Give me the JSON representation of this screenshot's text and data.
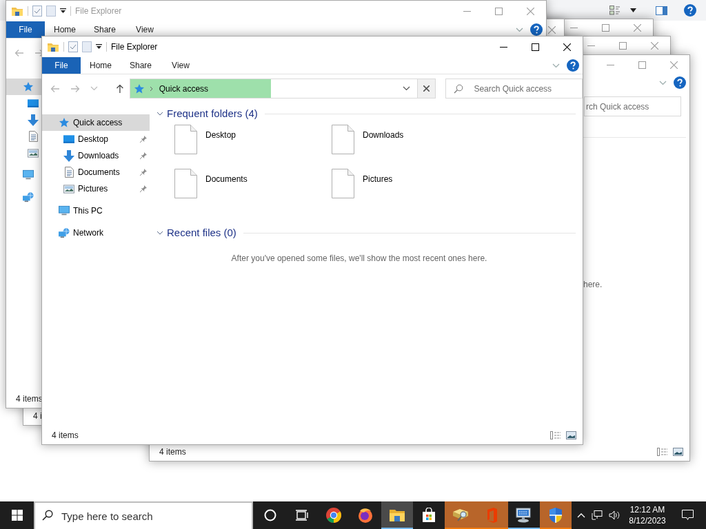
{
  "window_back_right": {
    "search_placeholder": "rch Quick access",
    "message": "here.",
    "status": "4 items"
  },
  "window_back_lower": {
    "status": "4 i"
  },
  "window_back_left": {
    "title": "File Explorer",
    "ribbon_tabs": [
      {
        "label": "File",
        "selected": true
      },
      {
        "label": "Home",
        "selected": false
      },
      {
        "label": "Share",
        "selected": false
      },
      {
        "label": "View",
        "selected": false
      }
    ],
    "nav": [
      {
        "kind": "quick_access",
        "selected": true,
        "children": [
          {
            "kind": "desktop",
            "selected": false
          },
          {
            "kind": "downloads",
            "selected": false
          },
          {
            "kind": "documents",
            "selected": false
          },
          {
            "kind": "pictures",
            "selected": false
          }
        ]
      },
      {
        "kind": "pc",
        "selected": false
      },
      {
        "kind": "network",
        "selected": false
      }
    ],
    "status": "4 items"
  },
  "main_window": {
    "title": "File Explorer",
    "ribbon_tabs": [
      {
        "label": "File",
        "selected": true
      },
      {
        "label": "Home",
        "selected": false
      },
      {
        "label": "Share",
        "selected": false
      },
      {
        "label": "View",
        "selected": false
      }
    ],
    "address": {
      "location": "Quick access",
      "level": 0.53
    },
    "search_placeholder": "Search Quick access",
    "nav": [
      {
        "label": "Quick access",
        "kind": "quick_access",
        "selected": true,
        "children": [
          {
            "label": "Desktop",
            "kind": "desktop",
            "selected": false,
            "pinned": true
          },
          {
            "label": "Downloads",
            "kind": "downloads",
            "selected": false,
            "pinned": true
          },
          {
            "label": "Documents",
            "kind": "documents",
            "selected": false,
            "pinned": true
          },
          {
            "label": "Pictures",
            "kind": "pictures",
            "selected": false,
            "pinned": true
          }
        ]
      },
      {
        "label": "This PC",
        "kind": "pc",
        "selected": false
      },
      {
        "label": "Network",
        "kind": "network",
        "selected": false
      }
    ],
    "sections": [
      {
        "title": "Frequent folders (4)",
        "expanded": true,
        "items": [
          "Desktop",
          "Downloads",
          "Documents",
          "Pictures"
        ]
      },
      {
        "title": "Recent files (0)",
        "expanded": true,
        "message": "After you've opened some files, we'll show the most recent ones here."
      }
    ],
    "status": "4 items"
  },
  "taskbar": {
    "search_placeholder": "Type here to search",
    "apps": [
      {
        "kind": "cortana",
        "active": false,
        "running": false,
        "flashing": false
      },
      {
        "kind": "task_view",
        "active": false,
        "running": false,
        "flashing": false
      },
      {
        "kind": "chrome",
        "active": false,
        "running": false,
        "flashing": false
      },
      {
        "kind": "firefox",
        "active": false,
        "running": false,
        "flashing": false
      },
      {
        "kind": "explorer",
        "active": true,
        "running": true,
        "flashing": false
      },
      {
        "kind": "store",
        "active": false,
        "running": false,
        "flashing": false
      },
      {
        "kind": "drive_search",
        "active": false,
        "running": true,
        "flashing": true
      },
      {
        "kind": "office",
        "active": false,
        "running": true,
        "flashing": true
      },
      {
        "kind": "network_pc",
        "active": false,
        "running": true,
        "flashing": false
      },
      {
        "kind": "shield",
        "active": false,
        "running": true,
        "flashing": true
      }
    ],
    "time": "12:12 AM",
    "date": "8/12/2023"
  }
}
